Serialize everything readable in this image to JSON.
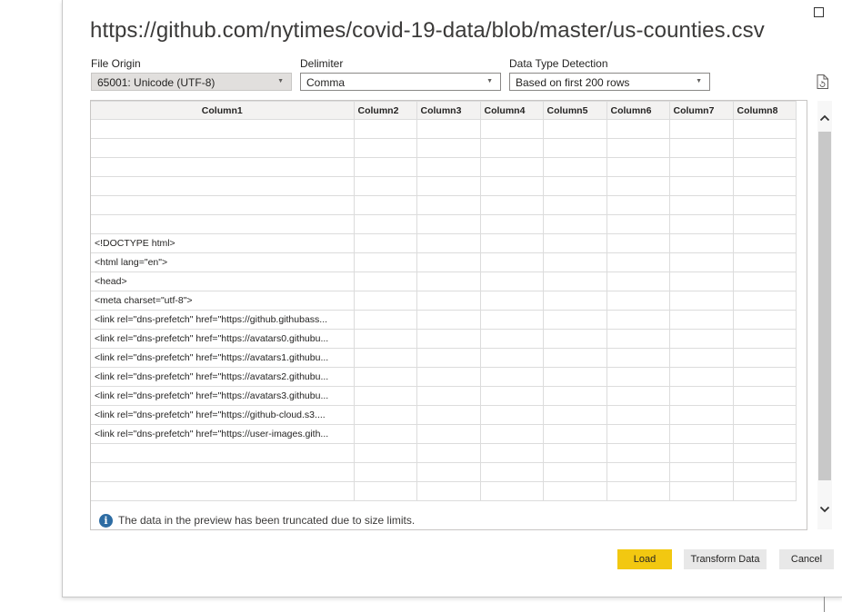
{
  "dialog": {
    "title": "https://github.com/nytimes/covid-19-data/blob/master/us-counties.csv"
  },
  "options": {
    "file_origin_label": "File Origin",
    "file_origin_value": "65001: Unicode (UTF-8)",
    "delimiter_label": "Delimiter",
    "delimiter_value": "Comma",
    "detection_label": "Data Type Detection",
    "detection_value": "Based on first 200 rows"
  },
  "grid": {
    "columns": [
      "Column1",
      "Column2",
      "Column3",
      "Column4",
      "Column5",
      "Column6",
      "Column7",
      "Column8"
    ],
    "rows": [
      "",
      "",
      "",
      "",
      "",
      "",
      "<!DOCTYPE html>",
      "<html lang=\"en\">",
      "<head>",
      "<meta charset=\"utf-8\">",
      "<link rel=\"dns-prefetch\" href=\"https://github.githubass...",
      "<link rel=\"dns-prefetch\" href=\"https://avatars0.githubu...",
      "<link rel=\"dns-prefetch\" href=\"https://avatars1.githubu...",
      "<link rel=\"dns-prefetch\" href=\"https://avatars2.githubu...",
      "<link rel=\"dns-prefetch\" href=\"https://avatars3.githubu...",
      "<link rel=\"dns-prefetch\" href=\"https://github-cloud.s3....",
      "<link rel=\"dns-prefetch\" href=\"https://user-images.gith...",
      "",
      "",
      ""
    ]
  },
  "info_message": "The data in the preview has been truncated due to size limits.",
  "buttons": {
    "load": "Load",
    "transform": "Transform Data",
    "cancel": "Cancel"
  },
  "colors": {
    "load_button": "#f2c811",
    "info_icon": "#2d6ca3"
  },
  "icons": {
    "info": "info-icon",
    "file_refresh": "file-refresh-icon",
    "scroll_up": "chevron-up-icon",
    "scroll_down": "chevron-down-icon"
  }
}
